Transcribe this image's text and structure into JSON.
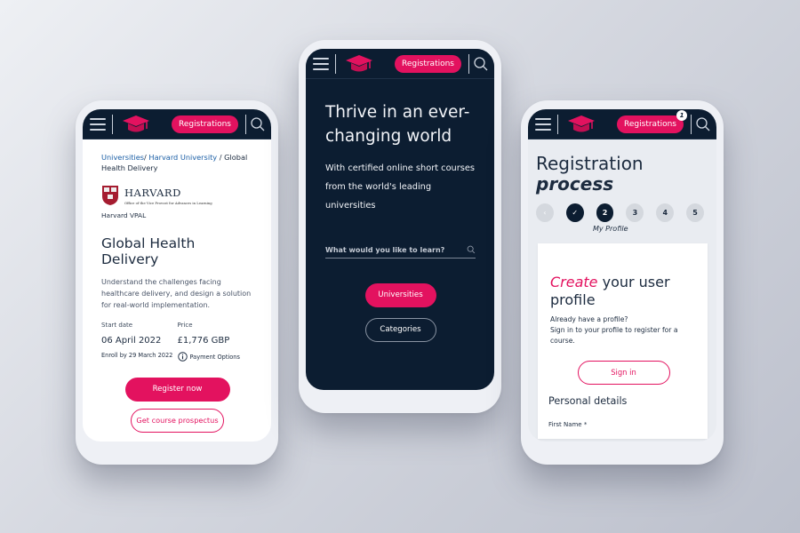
{
  "colors": {
    "brand_pink": "#e3125f",
    "navy": "#0c1d31",
    "link_blue": "#1b5fa6"
  },
  "navbar": {
    "menu_icon": "hamburger-icon",
    "logo_icon": "graduation-cap-icon",
    "registrations_label": "Registrations",
    "search_icon": "search-icon",
    "registrations_badge": "1"
  },
  "course_page": {
    "breadcrumb": {
      "items": [
        "Universities",
        "Harvard University"
      ],
      "separator": "/",
      "current": "Global Health Delivery"
    },
    "university": {
      "logo_name": "HARVARD",
      "logo_subtitle": "Office of the Vice Provost for Advances in Learning",
      "short_name": "Harvard VPAL"
    },
    "title": "Global Health Delivery",
    "description": "Understand the challenges facing healthcare delivery, and design a solution for real-world implementation.",
    "start_date_label": "Start date",
    "start_date": "06 April 2022",
    "enroll_by": "Enroll by 29 March 2022",
    "price_label": "Price",
    "price": "£1,776 GBP",
    "payment_options": "Payment Options",
    "register_button": "Register now",
    "prospectus_button": "Get course prospectus"
  },
  "home_page": {
    "hero_title": "Thrive in an ever-changing world",
    "hero_subtitle": "With certified online short courses from the world's leading universities",
    "search_placeholder": "What would you like to learn?",
    "universities_button": "Universities",
    "categories_button": "Categories"
  },
  "registration_page": {
    "title_line1": "Registration",
    "title_line2": "process",
    "steps": [
      {
        "label": "‹",
        "state": "nav"
      },
      {
        "label": "✓",
        "state": "done"
      },
      {
        "label": "2",
        "state": "active"
      },
      {
        "label": "3",
        "state": "todo"
      },
      {
        "label": "4",
        "state": "todo"
      },
      {
        "label": "5",
        "state": "todo"
      }
    ],
    "current_step_label": "My Profile",
    "card_title_emphasis": "Create",
    "card_title_rest": " your user profile",
    "card_text_line1": "Already have a profile?",
    "card_text_line2": "Sign in to your profile to register for a course.",
    "signin_button": "Sign in",
    "section_title": "Personal details",
    "first_name_label": "First Name *"
  }
}
